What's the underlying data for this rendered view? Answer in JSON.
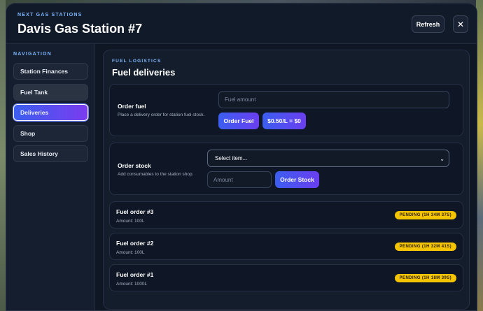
{
  "colors": {
    "accent_blue": "#3b5ef0",
    "accent_purple": "#7a3cf0",
    "eyebrow": "#7fb8ff",
    "badge_pending": "#f5c400",
    "panel_bg": "#0f1624"
  },
  "header": {
    "eyebrow": "NEXT GAS STATIONS",
    "title": "Davis Gas Station #7",
    "refresh_label": "Refresh",
    "close_icon": "close-icon",
    "close_glyph": "✕"
  },
  "sidebar": {
    "title": "NAVIGATION",
    "items": [
      {
        "label": "Station Finances"
      },
      {
        "label": "Fuel Tank"
      },
      {
        "label": "Deliveries"
      },
      {
        "label": "Shop"
      },
      {
        "label": "Sales History"
      }
    ],
    "active": "Deliveries"
  },
  "main": {
    "eyebrow": "FUEL LOGISTICS",
    "title": "Fuel deliveries",
    "order_fuel": {
      "label": "Order fuel",
      "description": "Place a delivery order for station fuel stock.",
      "amount_placeholder": "Fuel amount",
      "order_button": "Order Fuel",
      "price_button": "$0.50/L = $0"
    },
    "order_stock": {
      "label": "Order stock",
      "description": "Add consumables to the station shop.",
      "select_value": "Select item...",
      "amount_placeholder": "Amount",
      "order_button": "Order Stock"
    },
    "orders": [
      {
        "name": "Fuel order #3",
        "amount": "Amount: 100L",
        "status": "PENDING (1H 34M 37S)"
      },
      {
        "name": "Fuel order #2",
        "amount": "Amount: 100L",
        "status": "PENDING (1H 32M 41S)"
      },
      {
        "name": "Fuel order #1",
        "amount": "Amount: 1000L",
        "status": "PENDING (1H 18M 39S)"
      }
    ]
  }
}
